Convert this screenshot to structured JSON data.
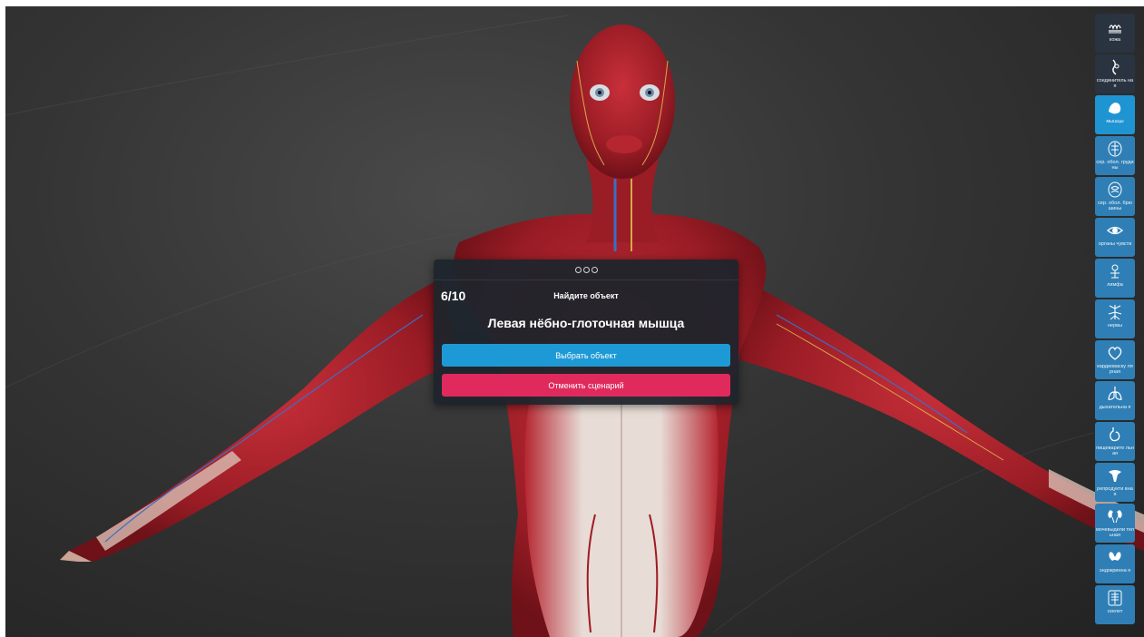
{
  "quiz": {
    "counter": "6/10",
    "title": "Найдите объект",
    "target": "Левая нёбно-глоточная мышца",
    "select_label": "Выбрать объект",
    "cancel_label": "Отменить сценарий"
  },
  "layers": [
    {
      "id": "skin",
      "label": "кожа",
      "icon": "skin-icon"
    },
    {
      "id": "connective",
      "label": "соединитель ная",
      "icon": "connective-tissue-icon"
    },
    {
      "id": "muscles",
      "label": "мышцы",
      "icon": "muscle-icon"
    },
    {
      "id": "serous-chest",
      "label": "сер. обол. грудины",
      "icon": "chest-serous-icon"
    },
    {
      "id": "serous-abdomen",
      "label": "сер. обол. брюшины",
      "icon": "abdomen-serous-icon"
    },
    {
      "id": "senses",
      "label": "органы чувств",
      "icon": "eye-icon"
    },
    {
      "id": "lymph",
      "label": "лимфа",
      "icon": "lymph-icon"
    },
    {
      "id": "nerves",
      "label": "нервы",
      "icon": "nerve-icon"
    },
    {
      "id": "cardio",
      "label": "кардиоваску лярная",
      "icon": "heart-icon"
    },
    {
      "id": "respiratory",
      "label": "дыхательна я",
      "icon": "lungs-icon"
    },
    {
      "id": "digestive",
      "label": "пищеварите льная",
      "icon": "stomach-icon"
    },
    {
      "id": "reproductive",
      "label": "репродукти вная",
      "icon": "reproductive-icon"
    },
    {
      "id": "urinary",
      "label": "мочевыдели тельная",
      "icon": "kidney-icon"
    },
    {
      "id": "endocrine",
      "label": "эндокринна я",
      "icon": "thyroid-icon"
    },
    {
      "id": "skeleton",
      "label": "скелет",
      "icon": "skeleton-icon"
    }
  ],
  "colors": {
    "select_button": "#1d9ad6",
    "cancel_button": "#e02a5e",
    "layer_active": "#1f94d2",
    "muscle": "#a8202a"
  }
}
